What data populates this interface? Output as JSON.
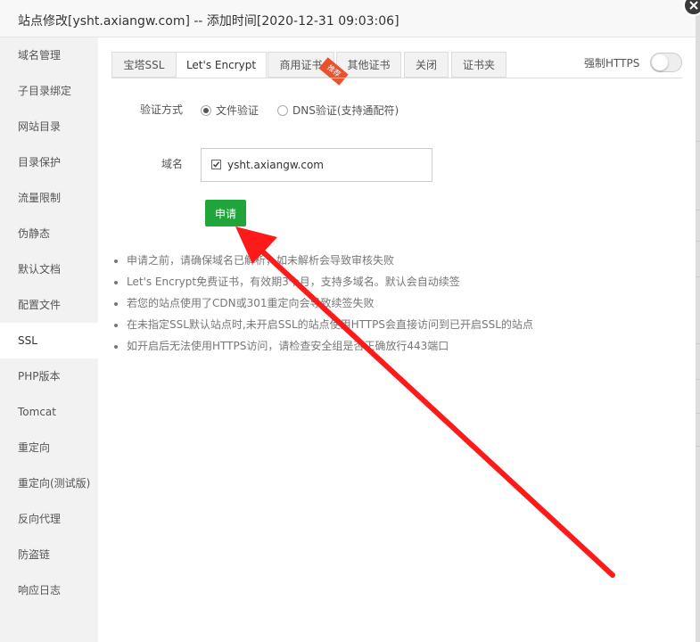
{
  "dialog": {
    "title": "站点修改[ysht.axiangw.com] -- 添加时间[2020-12-31 09:03:06]",
    "close_icon": "close-icon"
  },
  "sidebar": {
    "items": [
      {
        "label": "域名管理"
      },
      {
        "label": "子目录绑定"
      },
      {
        "label": "网站目录"
      },
      {
        "label": "目录保护"
      },
      {
        "label": "流量限制"
      },
      {
        "label": "伪静态"
      },
      {
        "label": "默认文档"
      },
      {
        "label": "配置文件"
      },
      {
        "label": "SSL",
        "active": true
      },
      {
        "label": "PHP版本"
      },
      {
        "label": "Tomcat"
      },
      {
        "label": "重定向"
      },
      {
        "label": "重定向(测试版)"
      },
      {
        "label": "反向代理"
      },
      {
        "label": "防盗链"
      },
      {
        "label": "响应日志"
      }
    ]
  },
  "tabs": {
    "items": [
      {
        "label": "宝塔SSL"
      },
      {
        "label": "Let's Encrypt",
        "active": true
      },
      {
        "label": "商用证书",
        "badge": "推荐"
      },
      {
        "label": "其他证书"
      },
      {
        "label": "关闭"
      },
      {
        "label": "证书夹"
      }
    ]
  },
  "force_https": {
    "label": "强制HTTPS",
    "enabled": false
  },
  "form": {
    "verify_label": "验证方式",
    "radio_file": "文件验证",
    "radio_dns": "DNS验证(支持通配符)",
    "selected": "file",
    "domain_label": "域名",
    "domain_value": "ysht.axiangw.com",
    "domain_checked": true,
    "apply_label": "申请"
  },
  "notes": [
    "申请之前，请确保域名已解析，如未解析会导致审核失败",
    "Let's Encrypt免费证书，有效期3个月，支持多域名。默认会自动续签",
    "若您的站点使用了CDN或301重定向会导致续签失败",
    "在未指定SSL默认站点时,未开启SSL的站点使用HTTPS会直接访问到已开启SSL的站点",
    "如开启后无法使用HTTPS访问，请检查安全组是否正确放行443端口"
  ],
  "colors": {
    "primary_green": "#20a53a",
    "arrow_red": "#ff1a1a",
    "ribbon": "#e8532e"
  }
}
